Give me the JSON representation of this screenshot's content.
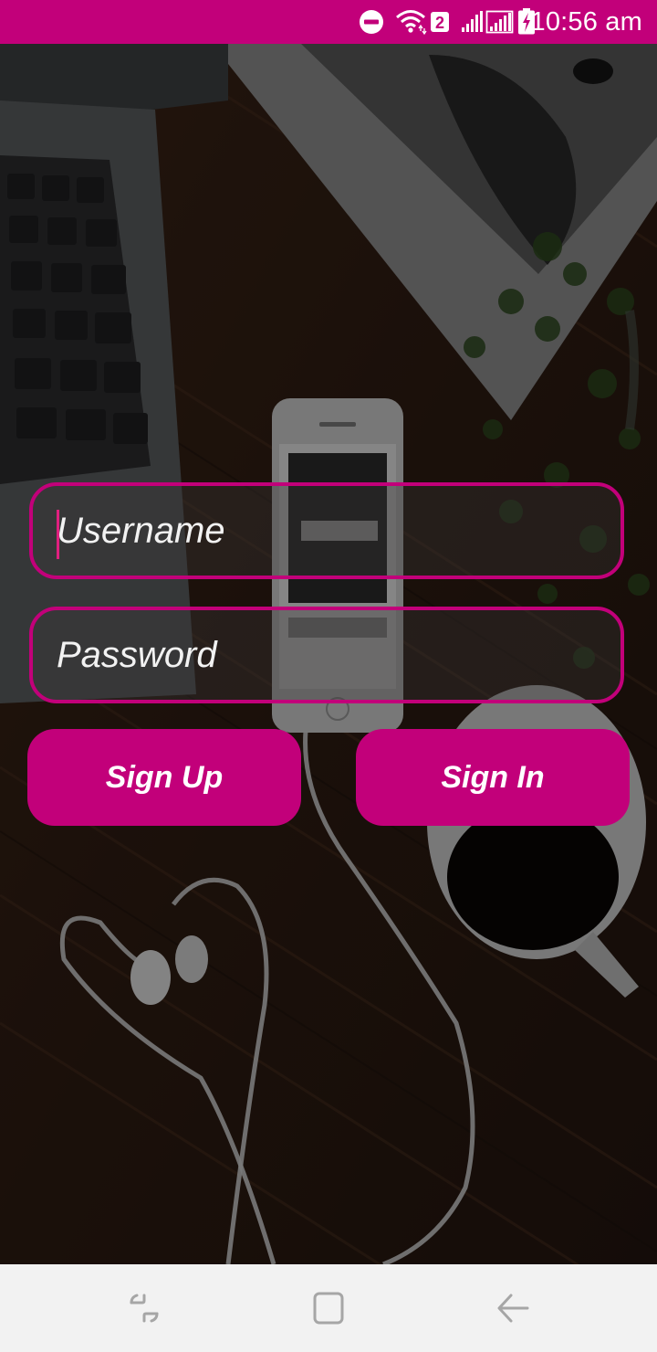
{
  "status_bar": {
    "time": "10:56 am",
    "sim_badge": "2",
    "icons": [
      "do-not-disturb-icon",
      "wifi-icon",
      "signal-icon",
      "signal-icon",
      "battery-charging-icon"
    ]
  },
  "login": {
    "username_placeholder": "Username",
    "username_value": "",
    "password_placeholder": "Password",
    "password_value": "",
    "signup_label": "Sign Up",
    "signin_label": "Sign In"
  },
  "nav_bar": {
    "icons": [
      "recents-icon",
      "home-icon",
      "back-icon"
    ]
  },
  "colors": {
    "accent": "#c2007a",
    "caret": "#e0207f",
    "nav_background": "#f2f2f2",
    "text": "#ffffff"
  }
}
